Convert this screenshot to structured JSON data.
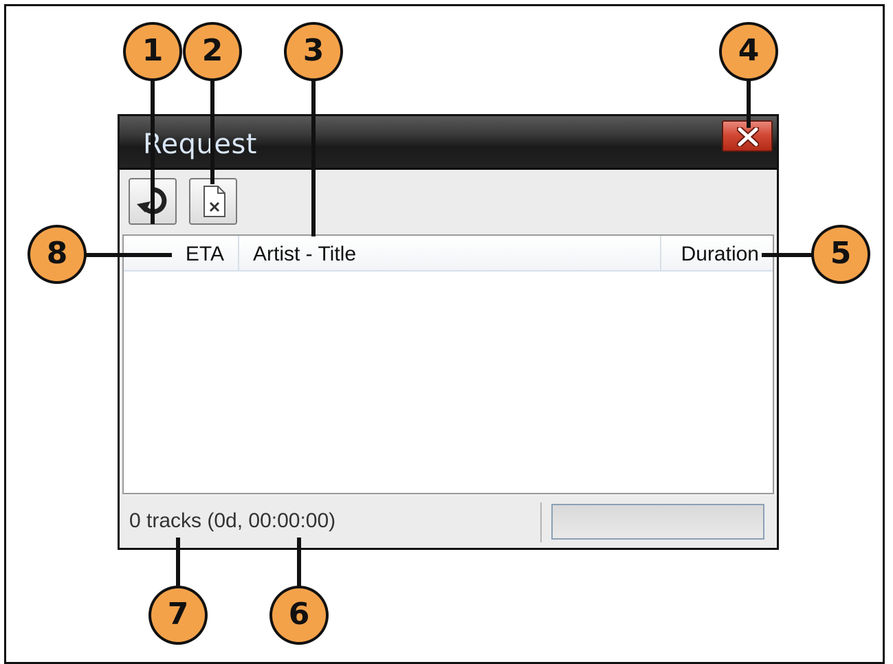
{
  "window": {
    "title": "Request",
    "close_icon": "close-icon"
  },
  "toolbar": {
    "refresh_icon": "refresh-icon",
    "clear_icon": "clear-list-icon"
  },
  "list": {
    "columns": [
      "ETA",
      "Artist - Title",
      "Duration"
    ],
    "rows": []
  },
  "status": {
    "text": "0 tracks (0d, 00:00:00)",
    "progress": 0
  },
  "callouts": [
    "1",
    "2",
    "3",
    "4",
    "5",
    "6",
    "7",
    "8"
  ],
  "colors": {
    "callout_fill": "#f4a24a",
    "close_button": "#d24a36",
    "titlebar": "#2a2a2a"
  }
}
